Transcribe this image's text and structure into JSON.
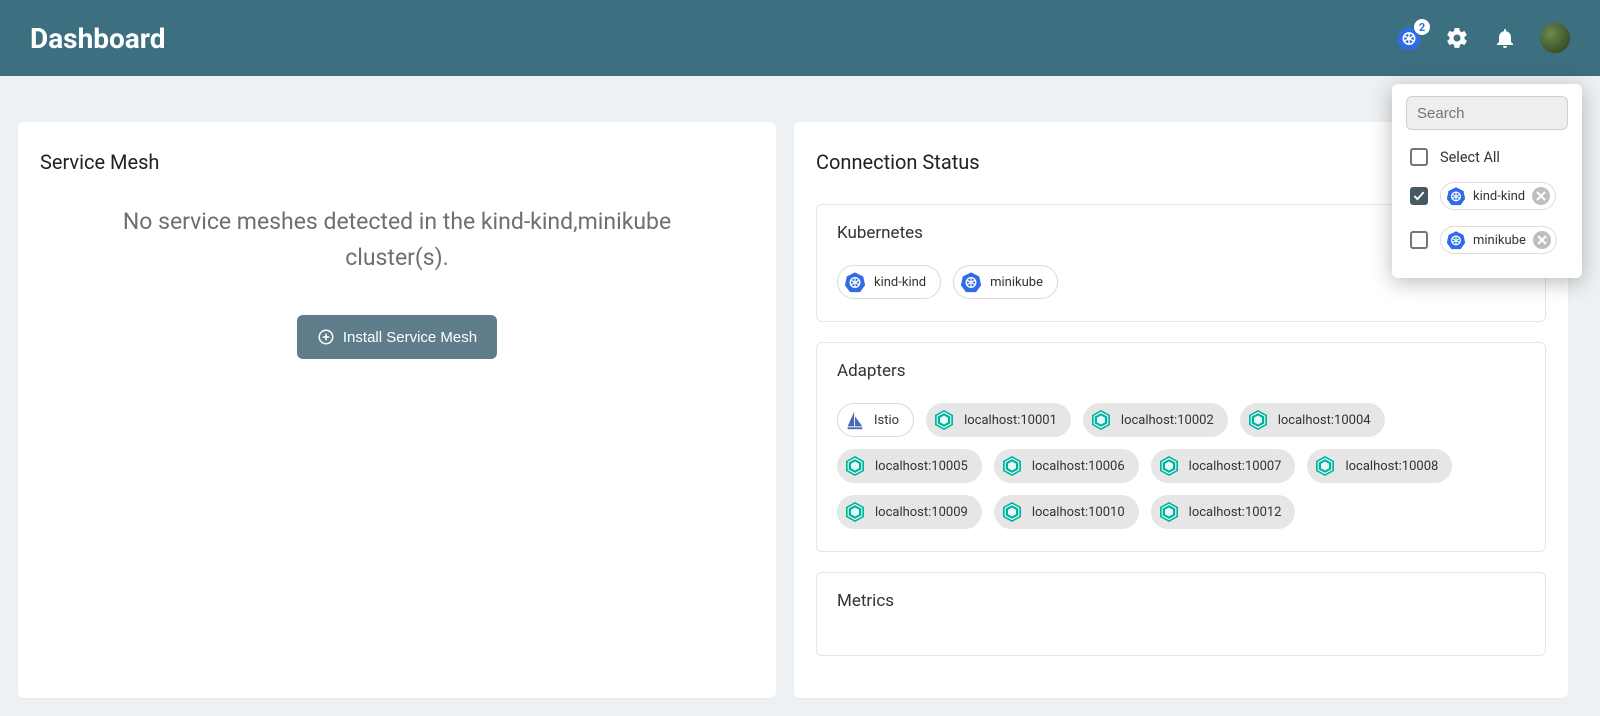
{
  "header": {
    "title": "Dashboard",
    "k8s_badge": "2"
  },
  "service_mesh": {
    "title": "Service Mesh",
    "empty_message": "No service meshes detected in the kind-kind,minikube cluster(s).",
    "install_label": "Install Service Mesh"
  },
  "connection": {
    "title": "Connection Status",
    "k8s": {
      "title": "Kubernetes",
      "clusters": [
        "kind-kind",
        "minikube"
      ]
    },
    "adapters": {
      "title": "Adapters",
      "istio": "Istio",
      "hosts": [
        "localhost:10001",
        "localhost:10002",
        "localhost:10004",
        "localhost:10005",
        "localhost:10006",
        "localhost:10007",
        "localhost:10008",
        "localhost:10009",
        "localhost:10010",
        "localhost:10012"
      ]
    },
    "metrics": {
      "title": "Metrics"
    }
  },
  "dropdown": {
    "search_placeholder": "Search",
    "select_all": "Select All",
    "options": [
      {
        "label": "kind-kind",
        "checked": true
      },
      {
        "label": "minikube",
        "checked": false
      }
    ]
  },
  "colors": {
    "topbar": "#3c6f80",
    "button": "#607d8b",
    "k8s_blue": "#326ce5",
    "meshery_green": "#00b39f",
    "istio_blue": "#466bb0"
  }
}
